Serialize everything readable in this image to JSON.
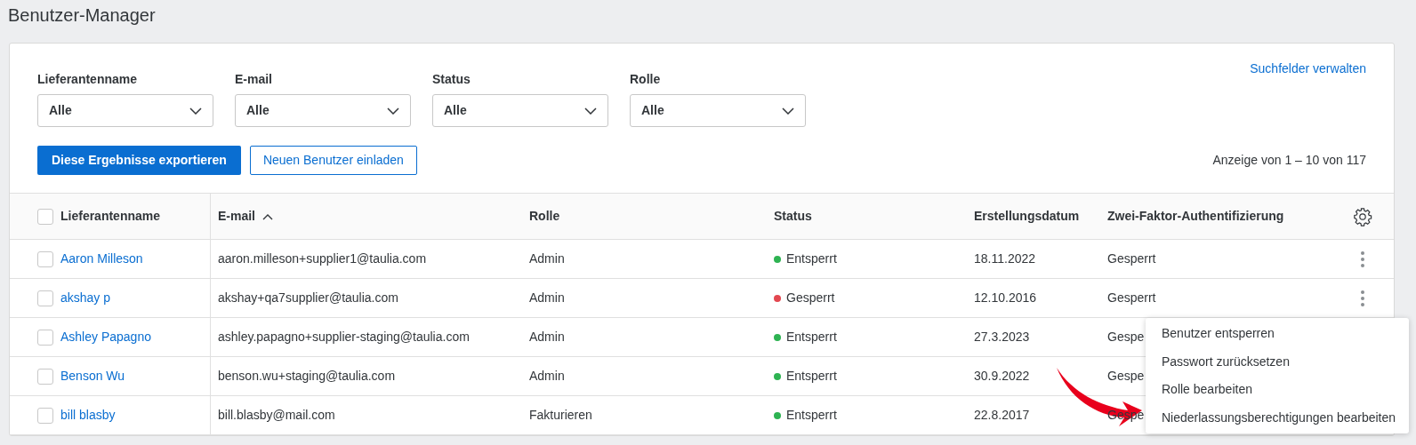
{
  "page_title": "Benutzer-Manager",
  "manage_fields_link": "Suchfelder verwalten",
  "filters": [
    {
      "label": "Lieferantenname",
      "value": "Alle"
    },
    {
      "label": "E-mail",
      "value": "Alle"
    },
    {
      "label": "Status",
      "value": "Alle"
    },
    {
      "label": "Rolle",
      "value": "Alle"
    }
  ],
  "export_button": "Diese Ergebnisse exportieren",
  "invite_button": "Neuen Benutzer einladen",
  "result_count": "Anzeige von 1 – 10 von 117",
  "table": {
    "select_all_checked": false,
    "columns": [
      {
        "label": "Lieferantenname",
        "sorted": false
      },
      {
        "label": "E-mail",
        "sorted": true
      },
      {
        "label": "Rolle",
        "sorted": false
      },
      {
        "label": "Status",
        "sorted": false
      },
      {
        "label": "Erstellungsdatum",
        "sorted": false
      },
      {
        "label": "Zwei-Faktor-Authentifizierung",
        "sorted": false
      }
    ],
    "rows": [
      {
        "checked": false,
        "name": "Aaron Milleson",
        "email": "aaron.milleson+supplier1@taulia.com",
        "role": "Admin",
        "status": "Entsperrt",
        "color": "#2eb352",
        "created": "18.11.2022",
        "two_factor": "Gesperrt",
        "menu_open": false
      },
      {
        "checked": false,
        "name": "akshay p",
        "email": "akshay+qa7supplier@taulia.com",
        "role": "Admin",
        "status": "Gesperrt",
        "color": "#e34850",
        "created": "12.10.2016",
        "two_factor": "Gesperrt",
        "menu_open": true
      },
      {
        "checked": false,
        "name": "Ashley Papagno",
        "email": "ashley.papagno+supplier-staging@taulia.com",
        "role": "Admin",
        "status": "Entsperrt",
        "color": "#2eb352",
        "created": "27.3.2023",
        "two_factor": "Gespe",
        "menu_open": false
      },
      {
        "checked": false,
        "name": "Benson Wu",
        "email": "benson.wu+staging@taulia.com",
        "role": "Admin",
        "status": "Entsperrt",
        "color": "#2eb352",
        "created": "30.9.2022",
        "two_factor": "Gespe",
        "menu_open": false
      },
      {
        "checked": false,
        "name": "bill blasby",
        "email": "bill.blasby@mail.com",
        "role": "Fakturieren",
        "status": "Entsperrt",
        "color": "#2eb352",
        "created": "22.8.2017",
        "two_factor": "Gespe",
        "menu_open": false
      }
    ]
  },
  "context_menu": [
    "Benutzer entsperren",
    "Passwort zurücksetzen",
    "Rolle bearbeiten",
    "Niederlassungsberechtigungen bearbeiten"
  ]
}
